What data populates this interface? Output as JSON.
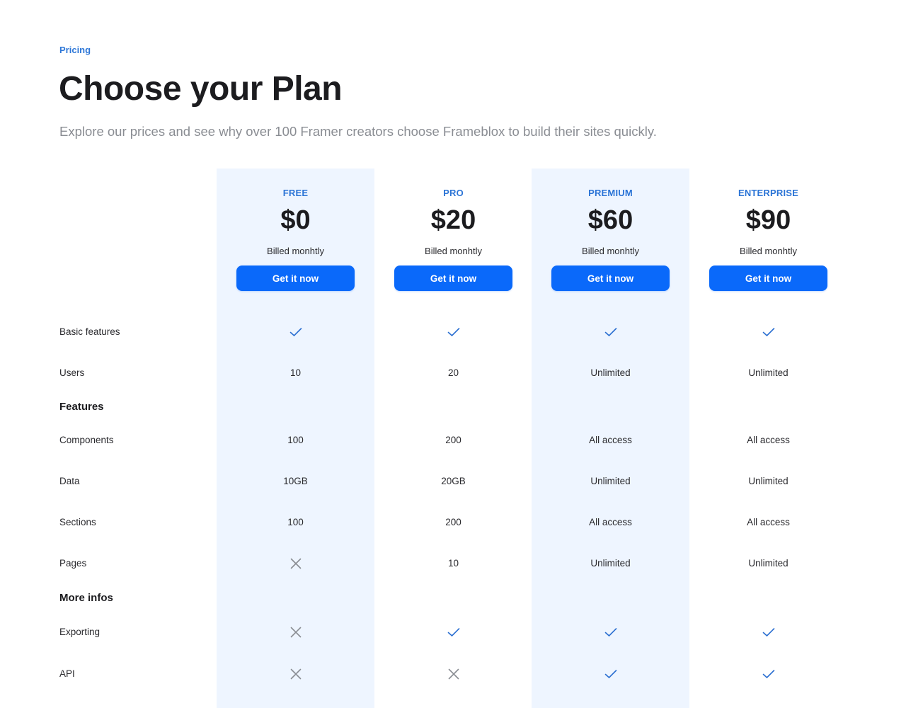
{
  "header": {
    "eyebrow": "Pricing",
    "title": "Choose your Plan",
    "subtitle": "Explore our prices and see why over 100 Framer creators choose Frameblox to build their sites quickly."
  },
  "colors": {
    "accent": "#0a69fa",
    "accent_text": "#2b74d6",
    "highlight_column_bg": "#eef5ff",
    "check": "#2b6fd1",
    "cross": "#8a8d93"
  },
  "plans": [
    {
      "name": "FREE",
      "price": "$0",
      "billing": "Billed monhtly",
      "cta": "Get it now",
      "highlighted": true
    },
    {
      "name": "PRO",
      "price": "$20",
      "billing": "Billed monhtly",
      "cta": "Get it now",
      "highlighted": false
    },
    {
      "name": "PREMIUM",
      "price": "$60",
      "billing": "Billed monhtly",
      "cta": "Get it now",
      "highlighted": true
    },
    {
      "name": "ENTERPRISE",
      "price": "$90",
      "billing": "Billed monhtly",
      "cta": "Get it now",
      "highlighted": false
    }
  ],
  "rows": [
    {
      "label": "Basic features",
      "type": "feature",
      "values": [
        "check-icon",
        "check-icon",
        "check-icon",
        "check-icon"
      ]
    },
    {
      "label": "Users",
      "type": "feature",
      "values": [
        "10",
        "20",
        "Unlimited",
        "Unlimited"
      ]
    },
    {
      "label": "Features",
      "type": "section",
      "values": []
    },
    {
      "label": "Components",
      "type": "feature",
      "values": [
        "100",
        "200",
        "All access",
        "All access"
      ]
    },
    {
      "label": "Data",
      "type": "feature",
      "values": [
        "10GB",
        "20GB",
        "Unlimited",
        "Unlimited"
      ]
    },
    {
      "label": "Sections",
      "type": "feature",
      "values": [
        "100",
        "200",
        "All access",
        "All access"
      ]
    },
    {
      "label": "Pages",
      "type": "feature",
      "values": [
        "cross-icon",
        "10",
        "Unlimited",
        "Unlimited"
      ]
    },
    {
      "label": "More infos",
      "type": "section",
      "values": []
    },
    {
      "label": "Exporting",
      "type": "feature",
      "values": [
        "cross-icon",
        "check-icon",
        "check-icon",
        "check-icon"
      ]
    },
    {
      "label": "API",
      "type": "feature",
      "values": [
        "cross-icon",
        "cross-icon",
        "check-icon",
        "check-icon"
      ]
    }
  ]
}
